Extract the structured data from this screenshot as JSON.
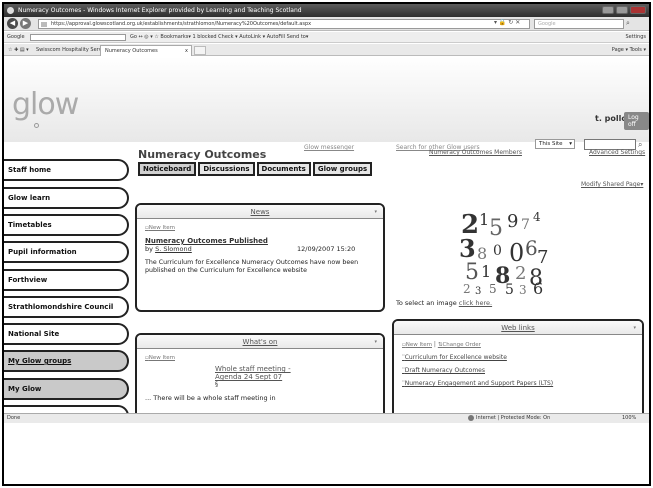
{
  "browser": {
    "title": "Numeracy Outcomes - Windows Internet Explorer provided by Learning and Teaching Scotland",
    "url": "https://approval.glowscotland.org.uk/establishments/strathlomon/Numeracy%20Outcomes/default.aspx",
    "search_placeholder": "Google",
    "google_label": "Google",
    "google_items": "Go ↔ ◎ ▾   ☆ Bookmarks▾   1 blocked   Check ▾   AutoLink ▾   AutoFill   Send to▾",
    "google_settings": "Settings",
    "fav_link": "Swisscom Hospitality Servi...",
    "tab_label": "Numeracy Outcomes",
    "tab_close": "x",
    "command_bar": "Page ▾  Tools ▾",
    "status_left": "Done",
    "status_zone": "Internet | Protected Mode: On",
    "status_zoom": "100%"
  },
  "header": {
    "logo": "glow",
    "username": "t. pollok",
    "logoff": "Log off",
    "glow_messenger": "Glow messenger",
    "search_users": "Search for other Glow users",
    "search_scope": "This Site"
  },
  "sidebar": {
    "items": [
      {
        "label": "Staff home"
      },
      {
        "label": "Glow learn"
      },
      {
        "label": "Timetables"
      },
      {
        "label": "Pupil information"
      },
      {
        "label": "Forthview"
      },
      {
        "label": "Strathlomondshire Council"
      },
      {
        "label": "National Site"
      },
      {
        "label": "My Glow groups"
      },
      {
        "label": "My Glow"
      }
    ]
  },
  "site": {
    "title": "Numeracy Outcomes",
    "tabs": [
      "Noticeboard",
      "Discussions",
      "Documents",
      "Glow groups"
    ],
    "members_link": "Numeracy Outcomes Members",
    "advanced_link": "Advanced Settings",
    "modify_link": "Modify Shared Page▾"
  },
  "news": {
    "title": "News",
    "new_item": "New Item",
    "heading": "Numeracy Outcomes Published",
    "by_prefix": "by",
    "author": "S. Slomond",
    "date": "12/09/2007 15:20",
    "body": "The Curriculum for Excellence Numeracy Outcomes have now been published on the Curriculum for Excellence website"
  },
  "image_widget": {
    "prefix": "To select an image ",
    "link": "click here."
  },
  "whats_on": {
    "title": "What's on",
    "new_item": "New Item",
    "meeting": "Whole staff meeting - Agenda 24 Sept 07",
    "meeting_suffix": "§",
    "truncated": "... There will be a whole staff meeting in"
  },
  "web_links": {
    "title": "Web links",
    "new_item": "New Item",
    "separator": " | ",
    "change_order": "Change Order",
    "links": [
      "Curriculum for Excellence website",
      "Draft Numeracy Outcomes",
      "Numeracy Engagement and Support Papers (LTS)"
    ]
  }
}
